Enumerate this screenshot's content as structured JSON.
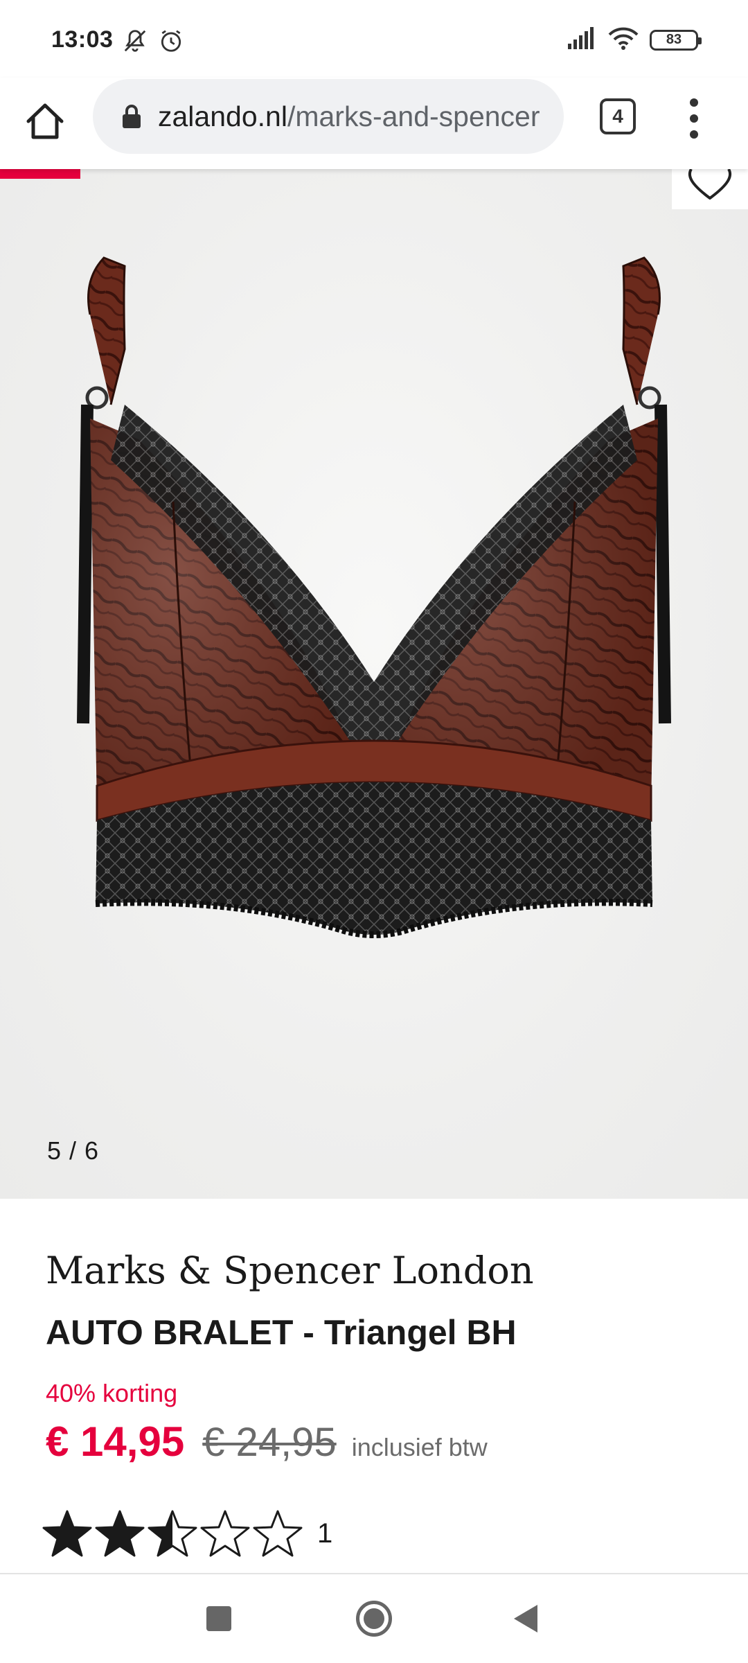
{
  "status_bar": {
    "time": "13:03",
    "battery": "83",
    "icons": [
      "mute-icon",
      "alarm-icon",
      "signal-icon",
      "wifi-icon",
      "battery-icon"
    ]
  },
  "browser": {
    "url_domain": "zalando.nl",
    "url_path": "/marks-and-spencer",
    "tab_count": "4"
  },
  "gallery": {
    "counter": "5 / 6",
    "current_index": 5,
    "total": 6
  },
  "product": {
    "brand": "Marks & Spencer London",
    "title": "AUTO BRALET - Triangel BH",
    "discount": "40% korting",
    "price": "€ 14,95",
    "original_price": "€ 24,95",
    "vat_note": "inclusief btw",
    "rating": 2.5,
    "rating_max": 5,
    "review_count": "1"
  },
  "colors": {
    "accent": "#e5003d",
    "product_brown": "#6b2a1c",
    "lace_black": "#141414"
  }
}
